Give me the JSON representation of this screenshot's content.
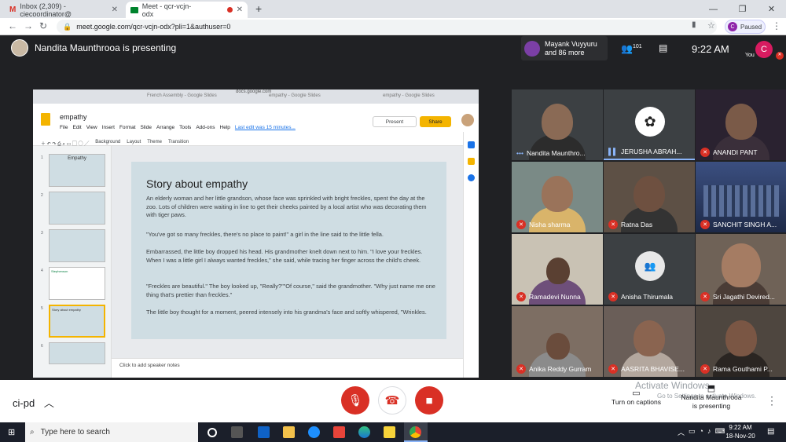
{
  "browser": {
    "tabs": [
      {
        "label": "Inbox (2,309) - ciecoordinator@"
      },
      {
        "label": "Meet - qcr-vcjn-odx"
      }
    ],
    "new_tab": "+",
    "url": "meet.google.com/qcr-vcjn-odx?pli=1&authuser=0",
    "profile_initial": "C",
    "paused_label": "Paused"
  },
  "meet": {
    "presenting_banner": "Nandita Maunthrooa is presenting",
    "participants_summary_1": "Mayank Vuyyuru",
    "participants_summary_2": "and 86 more",
    "people_count": "101",
    "time": "9:22 AM",
    "you_initial": "C",
    "you_label": "You",
    "meeting_code": "ci-pd",
    "captions_label": "Turn on captions",
    "presenting_label": "Nandita Maunthrooa is presenting",
    "watermark_1": "Activate Windows",
    "watermark_2": "Go to Settings to activate Windows."
  },
  "slides_app": {
    "window_tabs": [
      "French Assembly - Google Slides",
      "empathy - Google Slides",
      "empathy - Google Slides"
    ],
    "host": "docs.google.com",
    "doc_title": "empathy",
    "menus": [
      "File",
      "Edit",
      "View",
      "Insert",
      "Format",
      "Slide",
      "Arrange",
      "Tools",
      "Add-ons",
      "Help"
    ],
    "last_edit": "Last edit was 15 minutes...",
    "present_label": "Present",
    "share_label": "Share",
    "toolbar": [
      "Background",
      "Layout",
      "Theme",
      "Transition"
    ],
    "thumbnails": [
      {
        "num": "1",
        "text": "Empathy"
      },
      {
        "num": "2",
        "text": ""
      },
      {
        "num": "3",
        "text": ""
      },
      {
        "num": "4",
        "text": "Stephenson"
      },
      {
        "num": "5",
        "text": "Story about empathy"
      },
      {
        "num": "6",
        "text": ""
      }
    ],
    "notes_placeholder": "Click to add speaker notes",
    "slide": {
      "title": "Story about empathy",
      "paragraphs": [
        "An elderly woman and her little grandson, whose face was sprinkled with bright freckles, spent the day at the zoo.  Lots of children were waiting in line to get their cheeks painted by a local artist who was decorating them with tiger paws.",
        "\"You've got so many freckles, there's no place to paint!\" a girl in the line said to the little fella.",
        "Embarrassed, the little boy dropped his head. His grandmother knelt down next to him. \"I love your freckles. When I was a little girl I always wanted freckles,\" she said, while tracing her finger across the child's cheek.",
        "\"Freckles are beautiful.\" The boy looked up, \"Really?\"\"Of course,\" said the grandmother. \"Why just name me one thing that's prettier than freckles.\"",
        "The little boy thought for a moment, peered intensely into his grandma's face and softly whispered, \"Wrinkles."
      ]
    }
  },
  "tiles": [
    {
      "name": "Nandita Maunthro...",
      "muted": false,
      "bg": "#6b5a4e"
    },
    {
      "name": "JERUSHA ABRAH...",
      "muted": false,
      "bg": "#3c4043"
    },
    {
      "name": "ANANDI PANT",
      "muted": true,
      "bg": "#2a2230"
    },
    {
      "name": "Nisha sharma",
      "muted": true,
      "bg": "#7a8a86"
    },
    {
      "name": "Ratna Das",
      "muted": true,
      "bg": "#5d5045"
    },
    {
      "name": "SANCHIT SINGH A...",
      "muted": true,
      "bg": "#2b3a5a"
    },
    {
      "name": "Ramadevi Nunna",
      "muted": true,
      "bg": "#c9c2b4"
    },
    {
      "name": "Anisha Thirumala",
      "muted": true,
      "bg": "#3c4043"
    },
    {
      "name": "Sri Jagathi Devired...",
      "muted": true,
      "bg": "#6f6257"
    },
    {
      "name": "Anika Reddy Gurram",
      "muted": true,
      "bg": "#7d6e63"
    },
    {
      "name": "AASRITA BHAVISE...",
      "muted": true,
      "bg": "#6a5e58"
    },
    {
      "name": "Rama Gouthami P...",
      "muted": true,
      "bg": "#4e463f"
    }
  ],
  "taskbar": {
    "search_placeholder": "Type here to search",
    "time": "9:22 AM",
    "date": "18-Nov-20"
  },
  "colors": {
    "red": "#d93025",
    "accent": "#1a73e8",
    "slides_yellow": "#f4b400"
  }
}
